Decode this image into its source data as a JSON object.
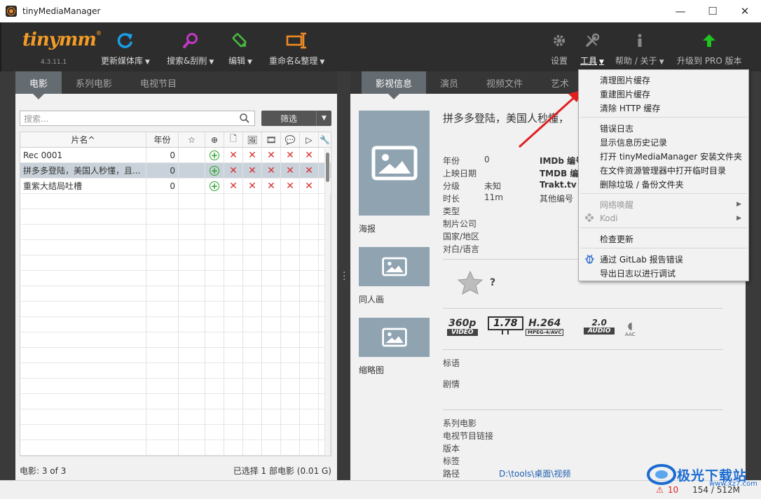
{
  "window": {
    "title": "tinyMediaManager",
    "minimize": "—",
    "maximize": "☐",
    "close": "✕"
  },
  "toolbar": {
    "logo": "tinymm",
    "logo_mark": "®",
    "version": "4.3.11.1",
    "buttons": [
      {
        "label": "更新媒体库",
        "icon": "refresh-icon"
      },
      {
        "label": "搜索&刮削",
        "icon": "magnify-icon"
      },
      {
        "label": "编辑",
        "icon": "pencil-icon"
      },
      {
        "label": "重命名&整理",
        "icon": "rename-icon"
      }
    ],
    "right_buttons": [
      {
        "label": "设置",
        "icon": "gear-icon"
      },
      {
        "label": "工具",
        "icon": "wrench-icon"
      },
      {
        "label": "帮助 / 关于",
        "icon": "info-icon"
      },
      {
        "label": "升级到 PRO 版本",
        "icon": "upgrade-arrow-icon"
      }
    ],
    "caret": "▼"
  },
  "left": {
    "tabs": [
      "电影",
      "系列电影",
      "电视节目"
    ],
    "search_placeholder": "搜索...",
    "filter_label": "筛选",
    "columns": {
      "title": "片名^",
      "year": "年份"
    },
    "rows": [
      {
        "title": "Rec 0001",
        "year": "0"
      },
      {
        "title": "拼多多登陆，美国人秒懂，且...",
        "year": "0"
      },
      {
        "title": "重紫大结局吐槽",
        "year": "0"
      }
    ],
    "status_left": "电影:  3  of  3",
    "status_right": "已选择 1 部电影 (0.01 G)"
  },
  "right": {
    "tabs": [
      "影视信息",
      "演员",
      "视频文件",
      "艺术"
    ],
    "movie_title": "拼多多登陆，美国人秒懂，",
    "art_labels": [
      "海报",
      "同人画",
      "缩略图"
    ],
    "info_labels": [
      "年份",
      "上映日期",
      "分级",
      "时长",
      "类型",
      "制片公司",
      "国家/地区",
      "对白/语言"
    ],
    "info_values": [
      "0",
      "",
      "未知",
      "11m"
    ],
    "id_labels": [
      "IMDb 编号",
      "TMDB 编号",
      "Trakt.tv ID",
      "其他编号"
    ],
    "rating_text": "?",
    "media": {
      "resolution": "360p",
      "video": "VIDEO",
      "aspect": "1.78",
      "codec": "H.264",
      "codec_sub": "MPEG-4/AVC",
      "channels": "2.0",
      "audio": "AUDIO",
      "aac": "AAC"
    },
    "tagline_label": "标语",
    "plot_label": "剧情",
    "bottom_labels": [
      "系列电影",
      "电视节目链接",
      "版本",
      "标签",
      "路径"
    ],
    "path_value": "D:\\tools\\桌面\\视频"
  },
  "status": {
    "warnings": "10",
    "memory": "154 / 512M"
  },
  "tools_menu": {
    "items": [
      {
        "label": "清理图片缓存"
      },
      {
        "label": "重建图片缓存"
      },
      {
        "label": "清除 HTTP 缓存"
      },
      {
        "label": "错误日志"
      },
      {
        "label": "显示信息历史记录"
      },
      {
        "label": "打开 tinyMediaManager 安装文件夹"
      },
      {
        "label": "在文件资源管理器中打开临时目录"
      },
      {
        "label": "删除垃圾 / 备份文件夹"
      },
      {
        "label": "网络唤醒"
      },
      {
        "label": "Kodi"
      },
      {
        "label": "检查更新"
      },
      {
        "label": "通过 GitLab 报告错误"
      },
      {
        "label": "导出日志以进行调试"
      }
    ],
    "submenu_arrow": "▶"
  },
  "watermark": {
    "text": "极光下载站",
    "sub": "www.xz7.com"
  },
  "colors": {
    "accent_orange": "#f39c26",
    "toolbar_bg": "#2d2d2d",
    "tab_active": "#646b71",
    "error_red": "#d83030",
    "ok_green": "#2aa52a",
    "art_bg": "#8fa3b1"
  }
}
